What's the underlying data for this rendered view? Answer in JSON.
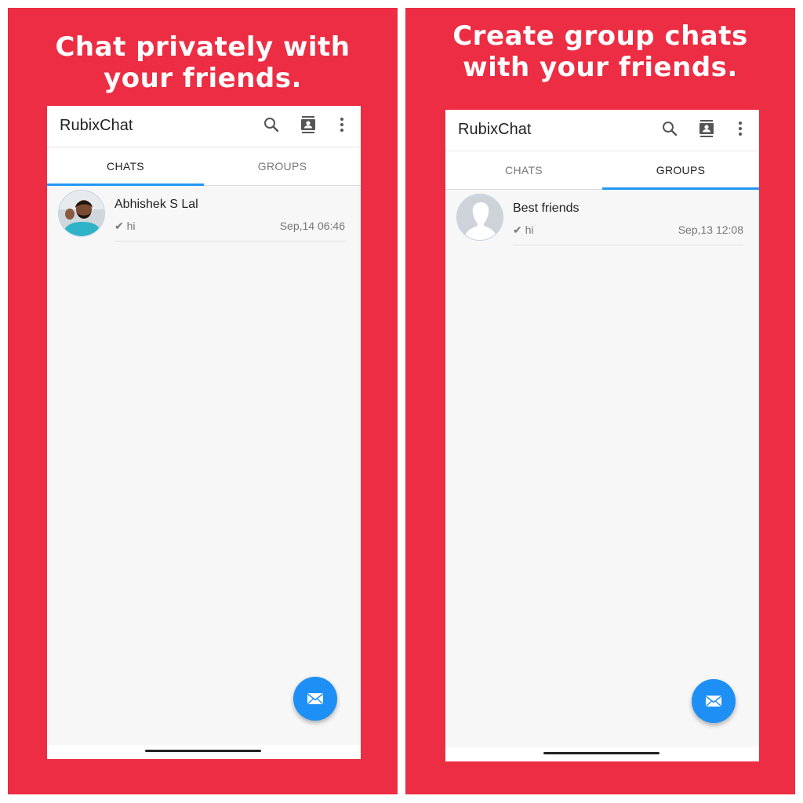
{
  "colors": {
    "panel_bg": "#ec2d43",
    "accent": "#2196f3",
    "fab": "#1e90f5"
  },
  "panels": [
    {
      "headline_line1": "Chat privately with",
      "headline_line2": "your friends.",
      "app": {
        "title": "RubixChat",
        "icons": [
          "search-icon",
          "contacts-icon",
          "more-vert-icon"
        ],
        "tabs": [
          {
            "label": "CHATS",
            "active": true
          },
          {
            "label": "GROUPS",
            "active": false
          }
        ],
        "items": [
          {
            "name": "Abhishek S Lal",
            "preview": "✔ hi",
            "time": "Sep,14  06:46",
            "avatar": "user-photo"
          }
        ],
        "fab_icon": "envelope-icon"
      }
    },
    {
      "headline_line1": "Create group chats",
      "headline_line2": "with your friends.",
      "app": {
        "title": "RubixChat",
        "icons": [
          "search-icon",
          "contacts-icon",
          "more-vert-icon"
        ],
        "tabs": [
          {
            "label": "CHATS",
            "active": false
          },
          {
            "label": "GROUPS",
            "active": true
          }
        ],
        "items": [
          {
            "name": "Best friends",
            "preview": "✔ hi",
            "time": "Sep,13  12:08",
            "avatar": "placeholder-silhouette"
          }
        ],
        "fab_icon": "envelope-icon"
      }
    }
  ]
}
